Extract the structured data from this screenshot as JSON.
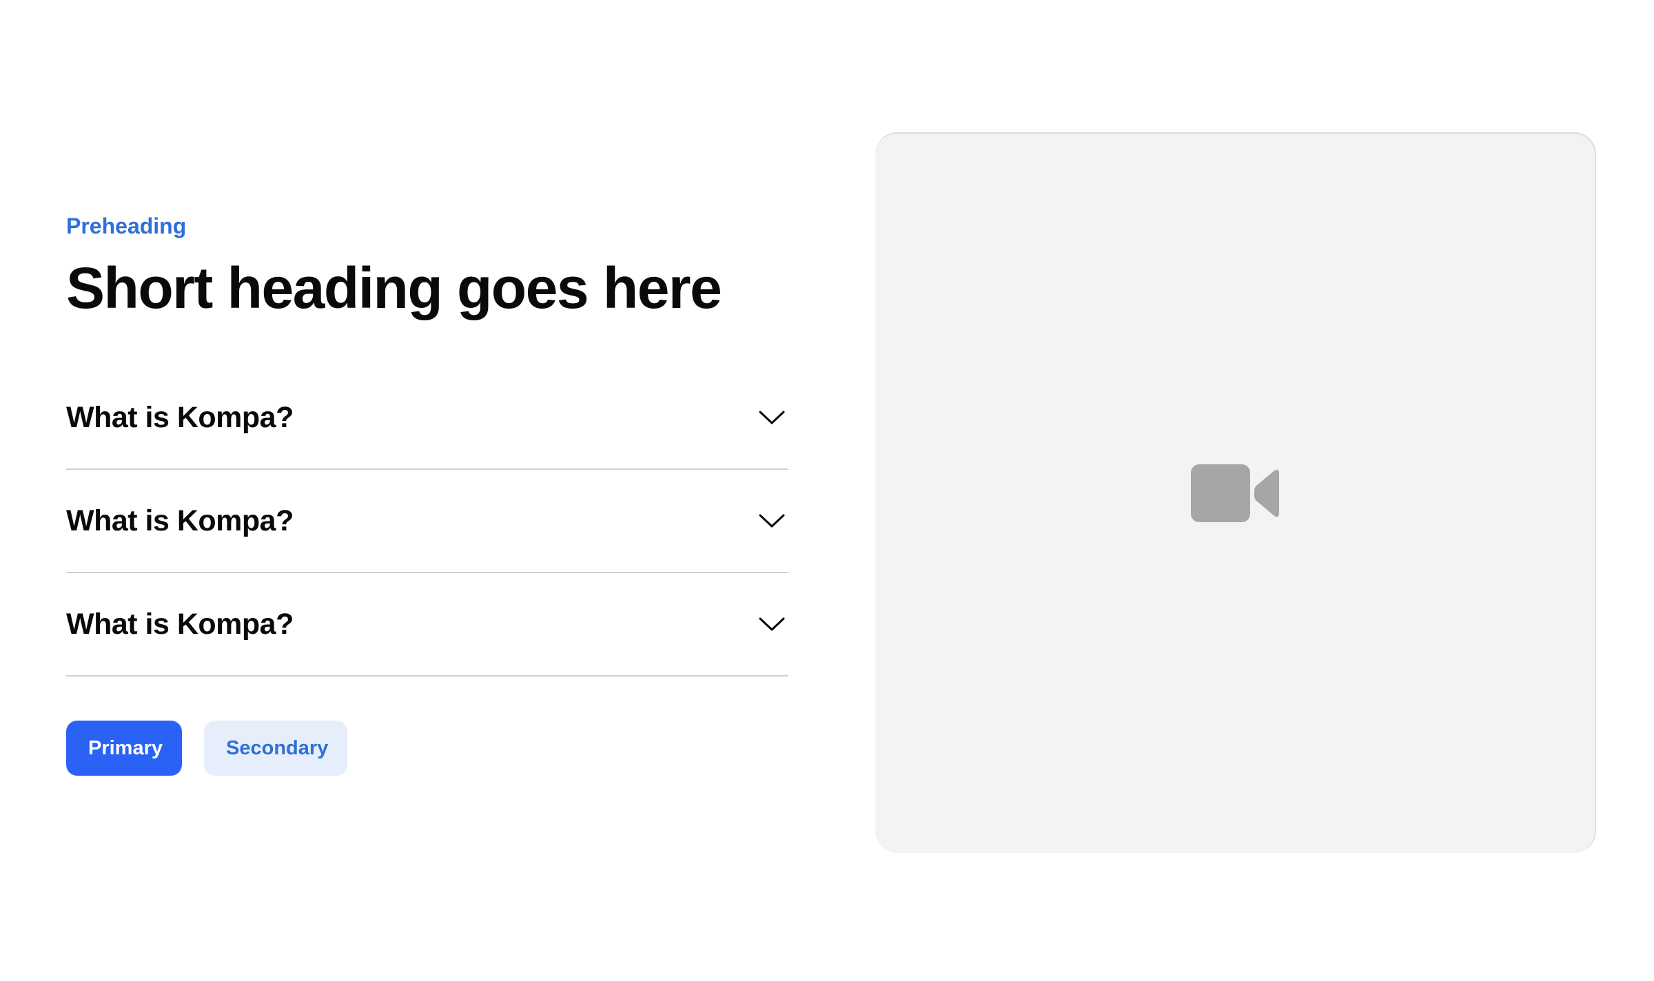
{
  "theme": {
    "accent_text": "#2f6fd8",
    "primary_bg": "#2962f4",
    "secondary_bg": "#e6eefb",
    "icon_color": "#a6a6a6"
  },
  "section": {
    "preheading": "Preheading",
    "heading": "Short heading goes here"
  },
  "faq": {
    "items": [
      {
        "question": "What is Kompa?",
        "icon": "chevron-down-icon"
      },
      {
        "question": "What is Kompa?",
        "icon": "chevron-down-icon"
      },
      {
        "question": "What is Kompa?",
        "icon": "chevron-down-icon"
      }
    ]
  },
  "actions": {
    "primary_label": "Primary",
    "secondary_label": "Secondary"
  },
  "media": {
    "icon": "video-camera-icon"
  }
}
